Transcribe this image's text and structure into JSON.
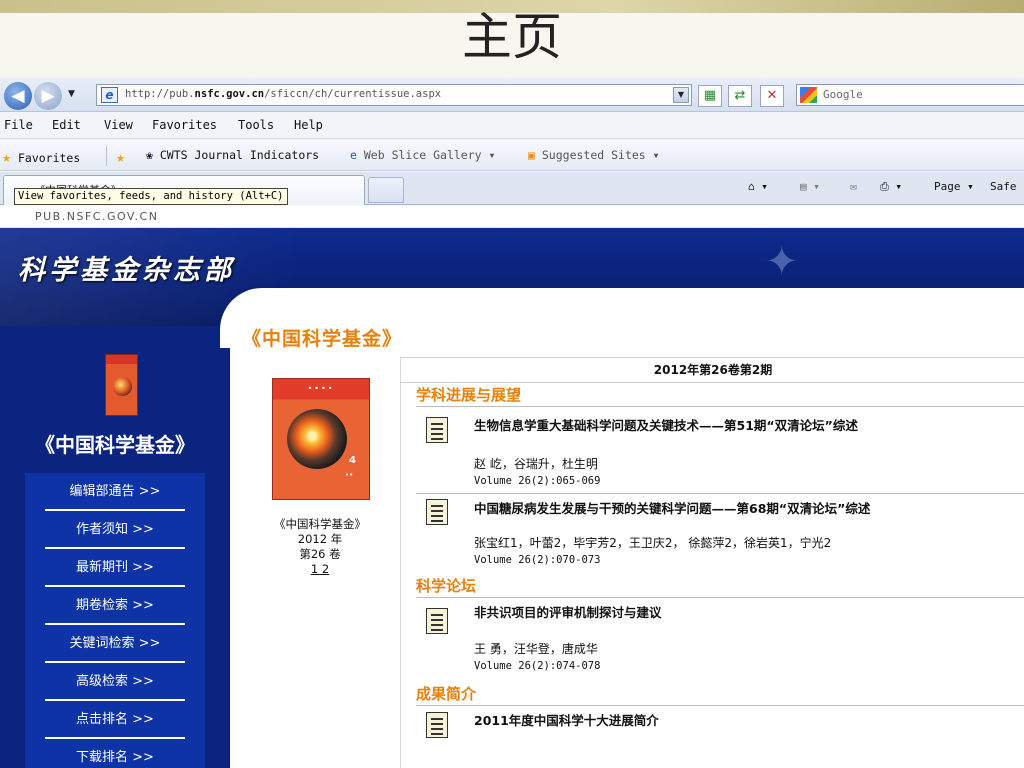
{
  "slide": {
    "title": "主页"
  },
  "browser": {
    "url_prefix": "http://pub.",
    "url_domain": "nsfc.gov.cn",
    "url_path": "/sficcn/ch/currentissue.aspx",
    "search_placeholder": "Google",
    "menu": [
      "File",
      "Edit",
      "View",
      "Favorites",
      "Tools",
      "Help"
    ],
    "favorites_label": "Favorites",
    "fav_links": [
      "CWTS Journal Indicators",
      "Web Slice Gallery ▾",
      "Suggested Sites ▾"
    ],
    "tab_title": "《中国科学基金》",
    "tooltip": "View favorites, feeds, and history (Alt+C)",
    "command_items": [
      "Page ▾",
      "Safe"
    ]
  },
  "site": {
    "domain_label": "PUB.NSFC.GOV.CN",
    "banner_title": "科学基金杂志部",
    "sidebar_title": "《中国科学基金》",
    "nav": [
      "编辑部通告 >>",
      "作者须知 >>",
      "最新期刊 >>",
      "期卷检索 >>",
      "关键词检索 >>",
      "高级检索 >>",
      "点击排名 >>",
      "下载排名 >>"
    ]
  },
  "content": {
    "page_title": "《中国科学基金》",
    "cover_caption": [
      "《中国科学基金》",
      "2012 年",
      "第26 卷"
    ],
    "cover_links": "1 2",
    "issue_header": "2012年第26卷第2期",
    "sections": [
      {
        "name": "学科进展与展望",
        "articles": [
          {
            "title": "生物信息学重大基础科学问题及关键技术——第51期“双清论坛”综述",
            "authors": "赵 屹，谷瑞升，杜生明",
            "volume": "Volume 26(2):065-069"
          },
          {
            "title": "中国糖尿病发生发展与干预的关键科学问题——第68期“双清论坛”综述",
            "authors": "张宝红1，叶蕾2，毕宇芳2，王卫庆2， 徐懿萍2，徐岩英1，宁光2",
            "volume": "Volume 26(2):070-073"
          }
        ]
      },
      {
        "name": "科学论坛",
        "articles": [
          {
            "title": "非共识项目的评审机制探讨与建议",
            "authors": "王 勇，汪华登，唐成华",
            "volume": "Volume 26(2):074-078"
          }
        ]
      },
      {
        "name": "成果简介",
        "articles": [
          {
            "title": "2011年度中国科学十大进展简介",
            "authors": "",
            "volume": ""
          }
        ]
      }
    ]
  }
}
